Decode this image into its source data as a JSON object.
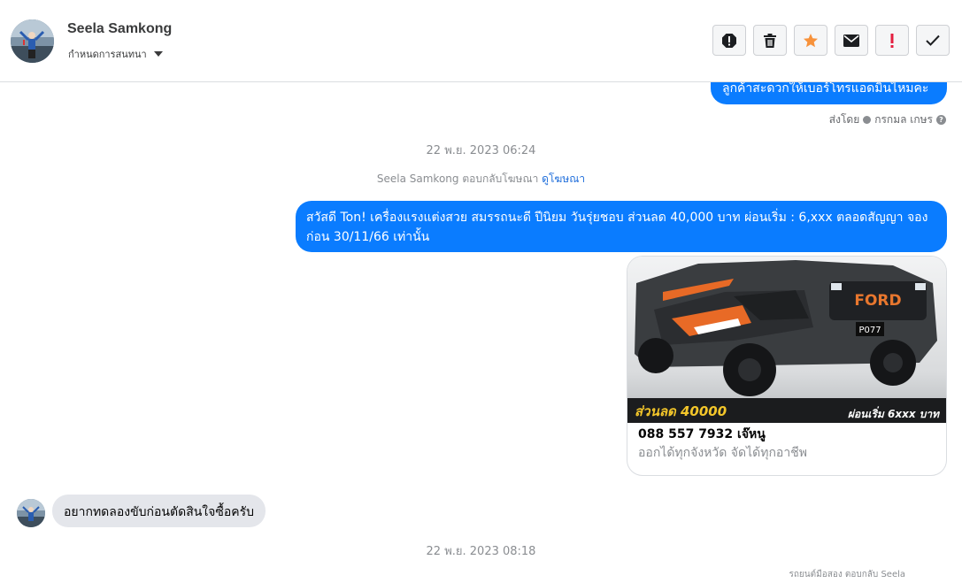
{
  "header": {
    "contact_name": "Seela Samkong",
    "assign_label": "กำหนดการสนทนา"
  },
  "toolbar": {
    "icons": [
      "alert-icon",
      "trash-icon",
      "star-icon",
      "envelope-icon",
      "exclamation-icon",
      "check-icon"
    ],
    "star_color": "#f7923b",
    "exclamation_color": "#e41e3f"
  },
  "messages": {
    "top_bubble_text": "ลูกค้าสะดวกให้เบอร์โทรแอดมินไหมคะ",
    "sent_by_label": "ส่งโดย",
    "sent_by_name": "กรกมล เกษร",
    "timestamp_1": "22 พ.ย. 2023 06:24",
    "reply_prefix": "Seela Samkong ตอบกลับโฆษณา",
    "reply_link": "ดูโฆษณา",
    "main_bubble_text": "สวัสดี Ton!  เครื่องแรงแต่งสวย สมรรถนะดี ปีนิยม วันรุ่ยชอบ ส่วนลด 40,000 บาท ผ่อนเริ่ม :  6,xxx ตลอดสัญญา จองก่อน 30/11/66 เท่านั้น",
    "incoming_text": "อยากทดลองขับก่อนตัดสินใจซื้อครับ",
    "timestamp_2": "22 พ.ย. 2023 08:18",
    "bottom_reply": "รถยนต์มือสอง ตอบกลับ Seela"
  },
  "ad_card": {
    "image": {
      "plate": "P077",
      "grille_text": "FORD",
      "discount_text": "ส่วนลด 40000",
      "installment_text": "ผ่อนเริ่ม 6xxx บาท"
    },
    "title": "088 557 7932 เจ๊หนู",
    "subtitle": "ออกได้ทุกจังหวัด จัดได้ทุกอาชีพ"
  },
  "colors": {
    "bubble_blue": "#0a7cff",
    "incoming_gray": "#e4e6eb",
    "timestamp_gray": "#8a8d91",
    "link_blue": "#216fdb"
  }
}
